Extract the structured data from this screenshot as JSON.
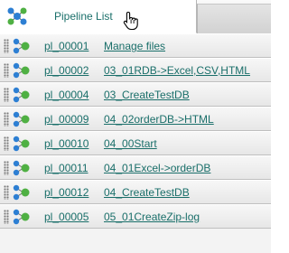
{
  "header": {
    "tab_label": "Pipeline List"
  },
  "pipelines": [
    {
      "id": "pl_00001",
      "name": "Manage files"
    },
    {
      "id": "pl_00002",
      "name": "03_01RDB->Excel,CSV,HTML"
    },
    {
      "id": "pl_00004",
      "name": "03_CreateTestDB"
    },
    {
      "id": "pl_00009",
      "name": "04_02orderDB->HTML"
    },
    {
      "id": "pl_00010",
      "name": "04_00Start"
    },
    {
      "id": "pl_00011",
      "name": "04_01Excel->orderDB"
    },
    {
      "id": "pl_00012",
      "name": "04_CreateTestDB"
    },
    {
      "id": "pl_00005",
      "name": "05_01CreateZip-log"
    }
  ],
  "icons": {
    "tab_icon": "pipeline-network-icon",
    "row_icon": "pipeline-node-icon",
    "cursor": "hand-pointer-icon",
    "grip": "drag-grip-icon"
  },
  "colors": {
    "link": "#1a6f6a",
    "node_blue": "#2d7fd3",
    "node_green": "#4fb043"
  }
}
